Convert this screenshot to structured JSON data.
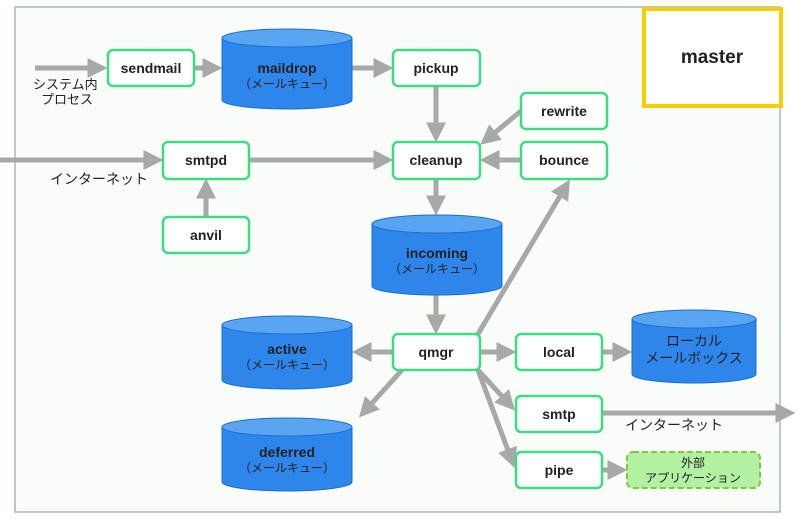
{
  "colors": {
    "node_border": "#3ddc84",
    "queue": "#2f86ea",
    "arrow": "#a8a8a8",
    "master_border": "#f5d000",
    "external_fill": "#b2f0a2",
    "external_border": "#7ccc3a"
  },
  "master": "master",
  "nodes": {
    "sendmail": "sendmail",
    "pickup": "pickup",
    "rewrite": "rewrite",
    "bounce": "bounce",
    "cleanup": "cleanup",
    "smtpd": "smtpd",
    "anvil": "anvil",
    "qmgr": "qmgr",
    "local": "local",
    "smtp": "smtp",
    "pipe": "pipe"
  },
  "queues": {
    "maildrop": {
      "name": "maildrop",
      "sub": "（メールキュー）"
    },
    "incoming": {
      "name": "incoming",
      "sub": "（メールキュー）"
    },
    "active": {
      "name": "active",
      "sub": "（メールキュー）"
    },
    "deferred": {
      "name": "deferred",
      "sub": "（メールキュー）"
    },
    "mailbox": {
      "line1": "ローカル",
      "line2": "メールボックス"
    }
  },
  "external": {
    "line1": "外部",
    "line2": "アプリケーション"
  },
  "labels": {
    "system_process_1": "システム内",
    "system_process_2": "プロセス",
    "internet_in": "インターネット",
    "internet_out": "インターネット"
  }
}
